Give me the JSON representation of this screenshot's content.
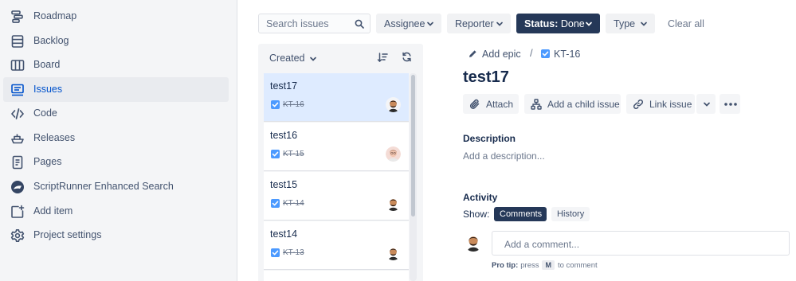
{
  "sidebar": {
    "items": [
      {
        "label": "Roadmap",
        "icon": "roadmap-icon"
      },
      {
        "label": "Backlog",
        "icon": "backlog-icon"
      },
      {
        "label": "Board",
        "icon": "board-icon"
      },
      {
        "label": "Issues",
        "icon": "issues-icon",
        "active": true
      },
      {
        "label": "Code",
        "icon": "code-icon"
      },
      {
        "label": "Releases",
        "icon": "ship-icon"
      },
      {
        "label": "Pages",
        "icon": "pages-icon"
      },
      {
        "label": "ScriptRunner Enhanced Search",
        "icon": "scriptrunner-icon"
      },
      {
        "label": "Add item",
        "icon": "add-item-icon"
      },
      {
        "label": "Project settings",
        "icon": "gear-icon"
      }
    ]
  },
  "filters": {
    "search_placeholder": "Search issues",
    "assignee": "Assignee",
    "reporter": "Reporter",
    "status_prefix": "Status:",
    "status_value": "Done",
    "type": "Type",
    "clear_all": "Clear all"
  },
  "list": {
    "sort_label": "Created",
    "issues": [
      {
        "title": "test17",
        "key": "KT-16",
        "selected": true
      },
      {
        "title": "test16",
        "key": "KT-15"
      },
      {
        "title": "test15",
        "key": "KT-14"
      },
      {
        "title": "test14",
        "key": "KT-13"
      }
    ]
  },
  "detail": {
    "add_epic": "Add epic",
    "breadcrumb_sep": "/",
    "issue_key": "KT-16",
    "title": "test17",
    "actions": {
      "attach": "Attach",
      "add_child": "Add a child issue",
      "link_issue": "Link issue"
    },
    "description_heading": "Description",
    "description_placeholder": "Add a description...",
    "activity_heading": "Activity",
    "show_label": "Show:",
    "tabs": {
      "comments": "Comments",
      "history": "History"
    },
    "comment_placeholder": "Add a comment...",
    "pro_tip_label": "Pro tip:",
    "pro_tip_press": "press",
    "pro_tip_key": "M",
    "pro_tip_rest": "to comment"
  },
  "colors": {
    "accent": "#0052cc",
    "status_button": "#253858",
    "selected_row": "#deebff",
    "checkbox": "#4c9aff",
    "sidebar_bg": "#f4f5f7"
  }
}
